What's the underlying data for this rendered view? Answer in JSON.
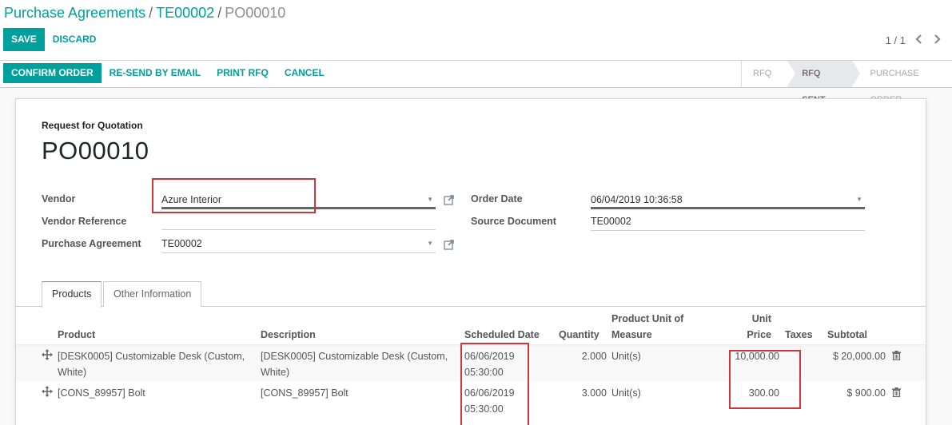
{
  "breadcrumb": {
    "items": [
      "Purchase Agreements",
      "TE00002"
    ],
    "current": "PO00010",
    "separator": "/"
  },
  "edit_buttons": {
    "save": "SAVE",
    "discard": "DISCARD"
  },
  "pager": {
    "value": "1 / 1",
    "prev": "‹",
    "next": "›"
  },
  "actions": {
    "confirm_order": "CONFIRM ORDER",
    "resend_email": "RE-SEND BY EMAIL",
    "print_rfq": "PRINT RFQ",
    "cancel": "CANCEL"
  },
  "statusbar": {
    "steps": [
      "RFQ",
      "RFQ SENT",
      "PURCHASE ORDER"
    ],
    "active": "RFQ SENT"
  },
  "form": {
    "title_label": "Request for Quotation",
    "name": "PO00010",
    "vendor_label": "Vendor",
    "vendor_value": "Azure Interior",
    "vendor_ref_label": "Vendor Reference",
    "vendor_ref_value": "",
    "agreement_label": "Purchase Agreement",
    "agreement_value": "TE00002",
    "order_date_label": "Order Date",
    "order_date_value": "06/04/2019 10:36:58",
    "source_doc_label": "Source Document",
    "source_doc_value": "TE00002"
  },
  "tabs": [
    {
      "label": "Products",
      "active": true
    },
    {
      "label": "Other Information",
      "active": false
    }
  ],
  "table": {
    "headers": {
      "product": "Product",
      "description": "Description",
      "scheduled_date": "Scheduled Date",
      "quantity": "Quantity",
      "uom_line1": "Product Unit of",
      "uom_line2": "Measure",
      "unit_price_line1": "Unit",
      "unit_price_line2": "Price",
      "taxes": "Taxes",
      "subtotal": "Subtotal"
    },
    "rows": [
      {
        "product_line1": "[DESK0005] Customizable Desk (Custom,",
        "product_line2": "White)",
        "description_line1": "[DESK0005] Customizable Desk (Custom,",
        "description_line2": "White)",
        "date_line1": "06/06/2019",
        "date_line2": "05:30:00",
        "quantity": "2.000",
        "uom": "Unit(s)",
        "unit_price": "10,000.00",
        "taxes": "",
        "subtotal": "$ 20,000.00"
      },
      {
        "product_line1": "[CONS_89957] Bolt",
        "product_line2": "",
        "description_line1": "[CONS_89957] Bolt",
        "description_line2": "",
        "date_line1": "06/06/2019",
        "date_line2": "05:30:00",
        "quantity": "3.000",
        "uom": "Unit(s)",
        "unit_price": "300.00",
        "taxes": "",
        "subtotal": "$ 900.00"
      }
    ]
  },
  "colors": {
    "brand": "#00a09d",
    "highlight": "#c9393c",
    "status_active_bg": "#e6e9ec"
  }
}
